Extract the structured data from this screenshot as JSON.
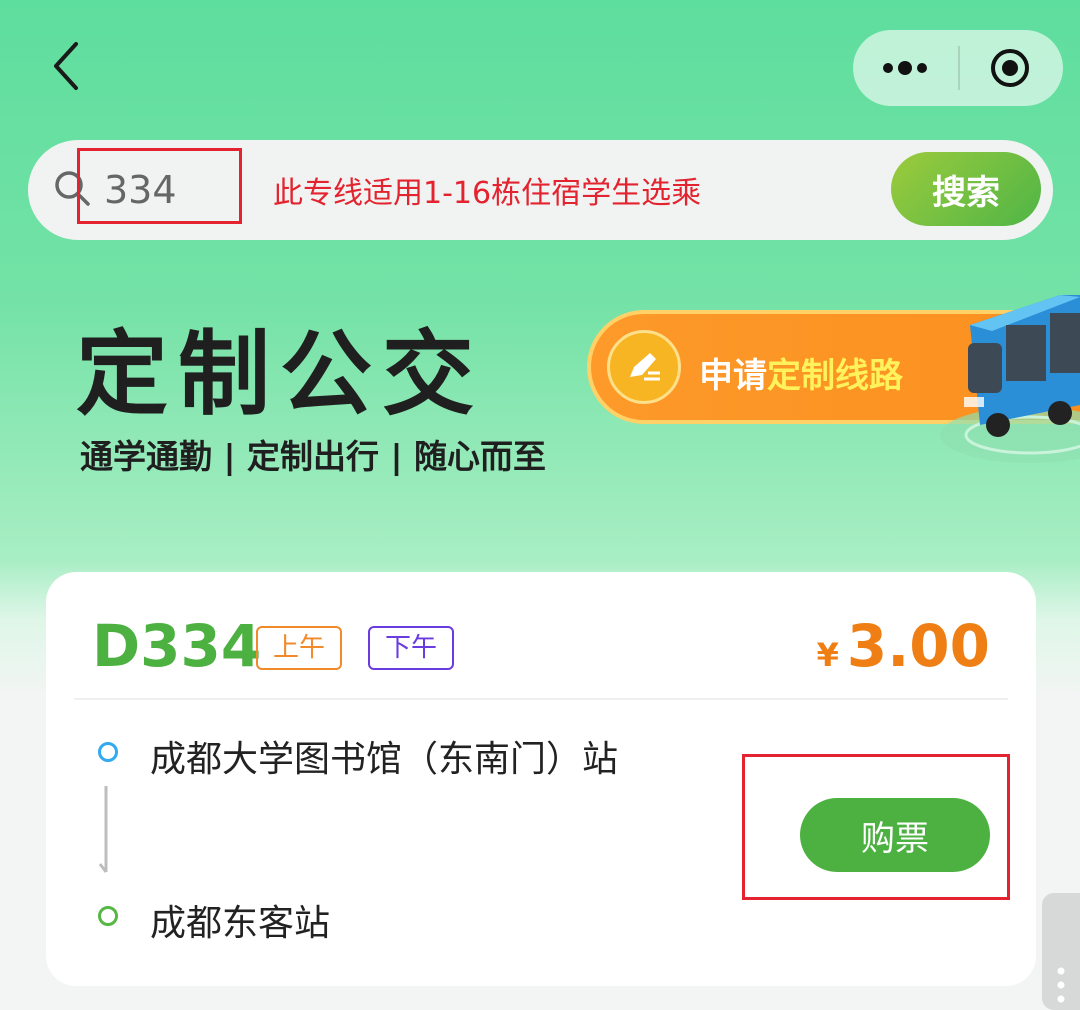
{
  "nav": {
    "back_icon": "chevron-left-icon",
    "more_icon": "more-dots-icon",
    "target_icon": "target-icon"
  },
  "search": {
    "value": "334",
    "notice": "此专线适用1-16栋住宿学生选乘",
    "button_label": "搜索"
  },
  "hero": {
    "title": "定制公交",
    "tagline": "通学通勤 | 定制出行 | 随心而至",
    "apply_prefix": "申请",
    "apply_highlight": "定制线路"
  },
  "route": {
    "code": "D334",
    "tags": [
      "上午",
      "下午"
    ],
    "price_symbol": "¥",
    "price": "3.00",
    "stops": [
      "成都大学图书馆（东南门）站",
      "成都东客站"
    ],
    "buy_label": "购票"
  },
  "colors": {
    "brand_green": "#4db142",
    "price_orange": "#ef7f14",
    "tag_am": "#f08a2b",
    "tag_pm": "#6a3ce0",
    "highlight_red": "#e3232f"
  }
}
